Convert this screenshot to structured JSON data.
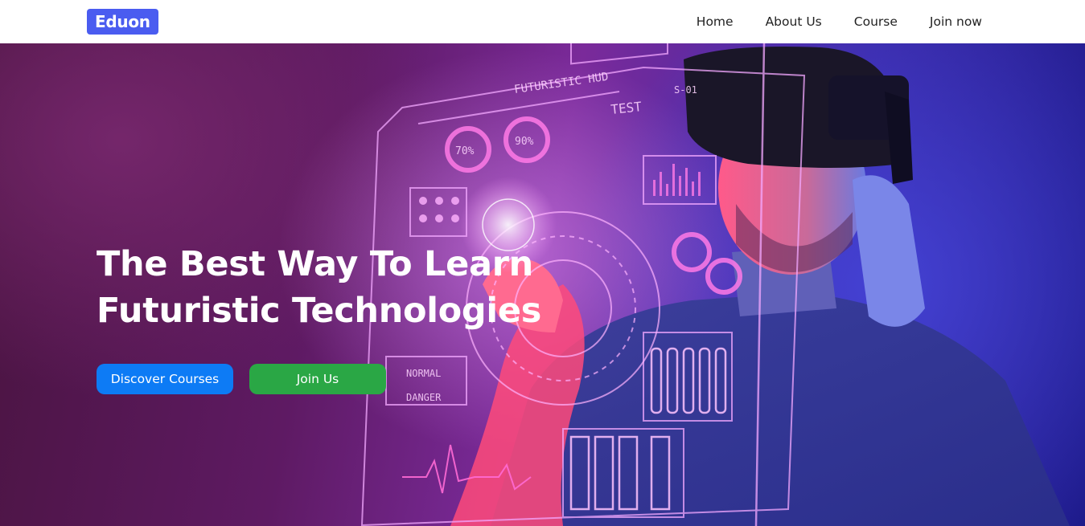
{
  "nav": {
    "logo": "Eduon",
    "links": [
      {
        "label": "Home"
      },
      {
        "label": "About Us"
      },
      {
        "label": "Course"
      },
      {
        "label": "Join now"
      }
    ]
  },
  "hero": {
    "title_line1": "The Best Way To Learn",
    "title_line2": "Futuristic Technologies",
    "discover_button": "Discover Courses",
    "join_button": "Join Us",
    "hud": {
      "header": "FUTURISTIC HUD",
      "test_label": "TEST",
      "gauge_left": "70%",
      "gauge_right": "90%",
      "tag_top": "S-01",
      "normal_label": "NORMAL",
      "danger_label": "DANGER"
    }
  },
  "colors": {
    "logo_bg": "#4a5cf0",
    "discover_bg": "#0d7bf5",
    "join_bg": "#2aa745",
    "nav_text": "#222222",
    "hero_text": "#ffffff"
  }
}
